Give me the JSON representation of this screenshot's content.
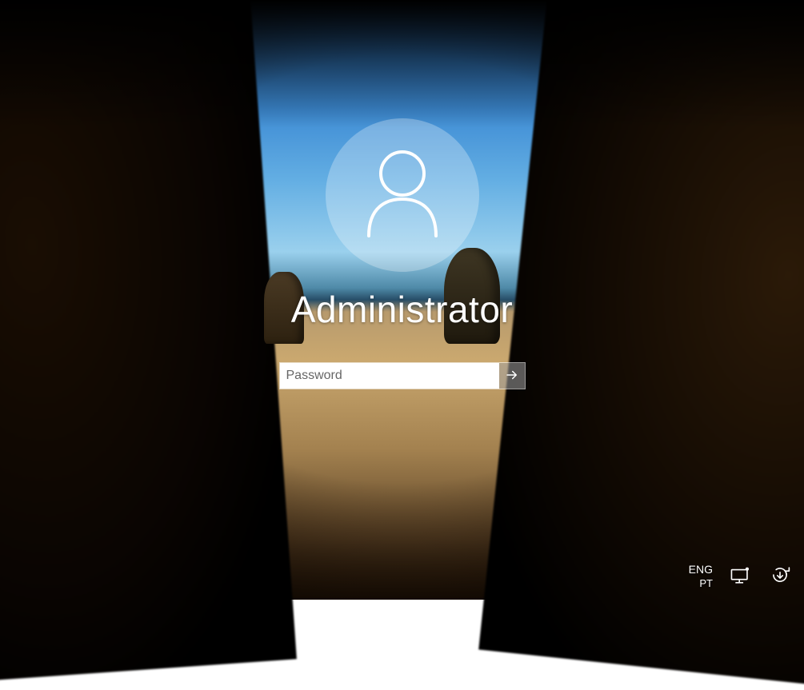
{
  "login": {
    "username": "Administrator",
    "password_placeholder": "Password",
    "password_value": ""
  },
  "corner": {
    "language_primary": "ENG",
    "language_secondary": "PT"
  },
  "icons": {
    "avatar": "user-icon",
    "submit": "arrow-right-icon",
    "ease_of_access": "ease-of-access-icon",
    "power": "power-update-icon"
  }
}
